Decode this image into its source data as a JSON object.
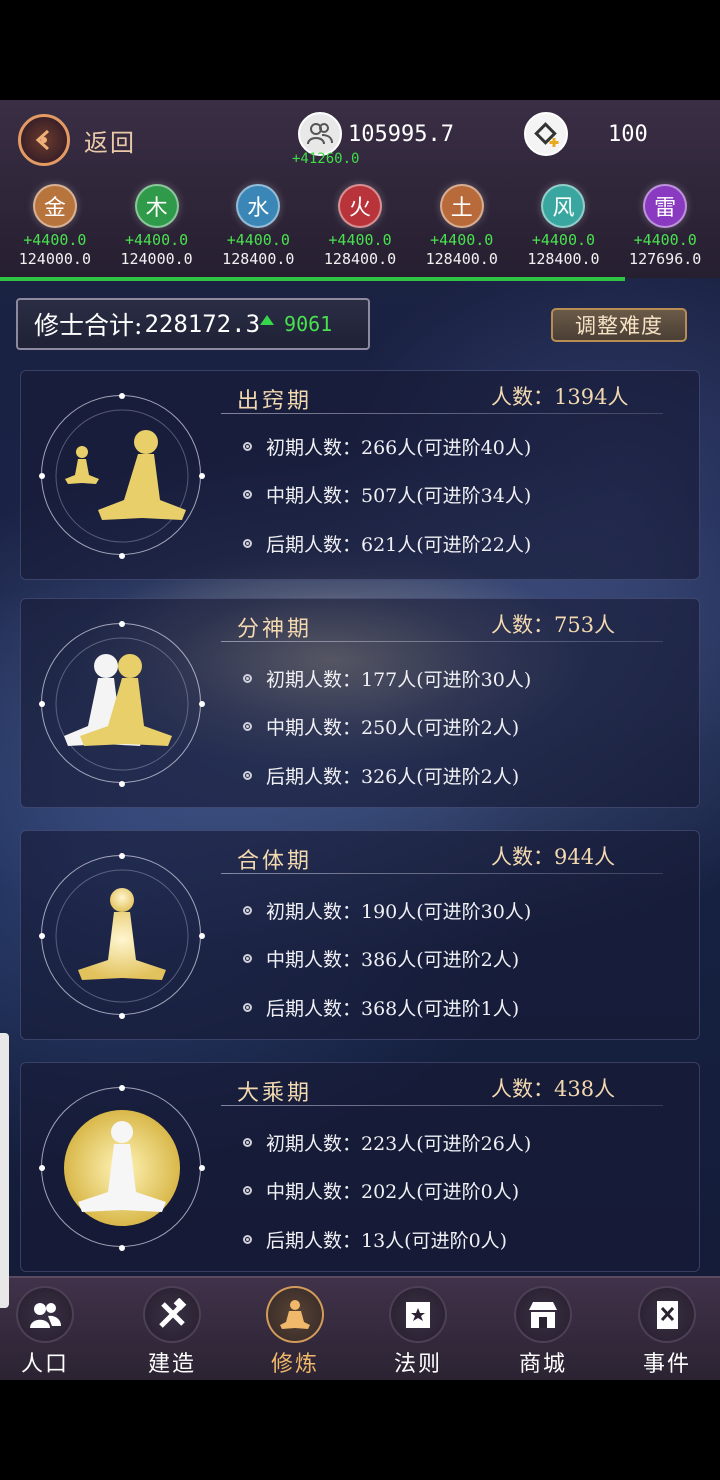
{
  "header": {
    "back_label": "返回",
    "population_value": "105995.7",
    "population_delta": "+41260.0",
    "gem_value": "100"
  },
  "elements": [
    {
      "name": "金",
      "delta": "+4400.0",
      "total": "124000.0",
      "color": "#b8743d"
    },
    {
      "name": "木",
      "delta": "+4400.0",
      "total": "124000.0",
      "color": "#2f9a4a"
    },
    {
      "name": "水",
      "delta": "+4400.0",
      "total": "128400.0",
      "color": "#3a86b6"
    },
    {
      "name": "火",
      "delta": "+4400.0",
      "total": "128400.0",
      "color": "#b8333a"
    },
    {
      "name": "土",
      "delta": "+4400.0",
      "total": "128400.0",
      "color": "#b86a3a"
    },
    {
      "name": "风",
      "delta": "+4400.0",
      "total": "128400.0",
      "color": "#3aa6a0"
    },
    {
      "name": "雷",
      "delta": "+4400.0",
      "total": "127696.0",
      "color": "#8a3ac0"
    }
  ],
  "summary": {
    "label": "修士合计:",
    "value": "228172.3",
    "delta": "9061",
    "adjust_label": "调整难度"
  },
  "stages": [
    {
      "name": "出窍期",
      "count": "人数：1394人",
      "rows": [
        "初期人数：266人(可进阶40人)",
        "中期人数：507人(可进阶34人)",
        "后期人数：621人(可进阶22人)"
      ]
    },
    {
      "name": "分神期",
      "count": "人数：753人",
      "rows": [
        "初期人数：177人(可进阶30人)",
        "中期人数：250人(可进阶2人)",
        "后期人数：326人(可进阶2人)"
      ]
    },
    {
      "name": "合体期",
      "count": "人数：944人",
      "rows": [
        "初期人数：190人(可进阶30人)",
        "中期人数：386人(可进阶2人)",
        "后期人数：368人(可进阶1人)"
      ]
    },
    {
      "name": "大乘期",
      "count": "人数：438人",
      "rows": [
        "初期人数：223人(可进阶26人)",
        "中期人数：202人(可进阶0人)",
        "后期人数：13人(可进阶0人)"
      ]
    }
  ],
  "nav": [
    {
      "label": "人口",
      "icon": "people-icon"
    },
    {
      "label": "建造",
      "icon": "tools-icon"
    },
    {
      "label": "修炼",
      "icon": "meditation-icon",
      "active": true
    },
    {
      "label": "法则",
      "icon": "law-banner-icon"
    },
    {
      "label": "商城",
      "icon": "shop-icon"
    },
    {
      "label": "事件",
      "icon": "event-book-icon"
    }
  ],
  "colors": {
    "accent": "#f0b86a",
    "green": "#49e04f",
    "gold": "#e8cf6a"
  }
}
